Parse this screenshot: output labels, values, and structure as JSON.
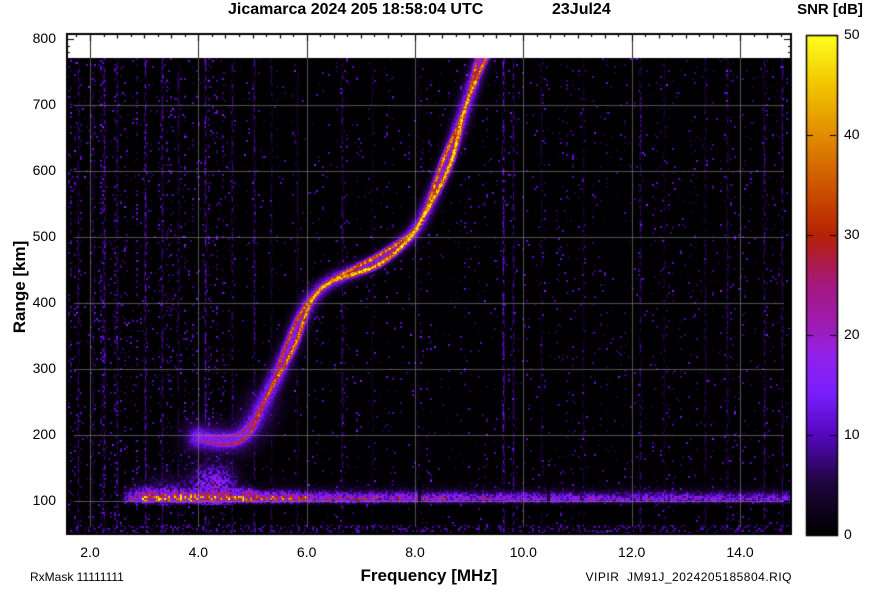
{
  "header": {
    "title": "Jicamarca 2024 205 18:58:04 UTC",
    "date": "23Jul24"
  },
  "colorbar": {
    "label": "SNR [dB]",
    "min": 0,
    "max": 50,
    "tick_labels": [
      "0",
      "10",
      "20",
      "30",
      "40",
      "50"
    ]
  },
  "axes": {
    "x_label": "Frequency [MHz]",
    "y_label": "Range [km]",
    "x_tick_labels": [
      "2.0",
      "4.0",
      "6.0",
      "8.0",
      "10.0",
      "12.0",
      "14.0"
    ],
    "y_tick_labels": [
      "100",
      "200",
      "300",
      "400",
      "500",
      "600",
      "700",
      "800"
    ]
  },
  "footer": {
    "rx_mask": "RxMask 11111111",
    "file": "VIPIR  JM91J_2024205185804.RIQ"
  },
  "chart_data": {
    "type": "heatmap",
    "title": "Jicamarca 2024 205 18:58:04 UTC",
    "date": "23Jul24",
    "xlabel": "Frequency [MHz]",
    "ylabel": "Range [km]",
    "colorbar_label": "SNR [dB]",
    "xlim": [
      1.55,
      14.97
    ],
    "ylim": [
      48,
      809
    ],
    "snr_lim": [
      0,
      50
    ],
    "grid": true,
    "x_major_ticks": [
      2,
      4,
      6,
      8,
      10,
      12,
      14
    ],
    "x_minor_step": 0.25,
    "y_major_ticks": [
      100,
      200,
      300,
      400,
      500,
      600,
      700,
      800
    ],
    "y_minor_step": 10,
    "colorbar_ticks": [
      0,
      10,
      20,
      30,
      40,
      50
    ],
    "palette_stops": [
      [
        0.0,
        "#000000"
      ],
      [
        0.1,
        "#1e053c"
      ],
      [
        0.2,
        "#5508be"
      ],
      [
        0.28,
        "#781efc"
      ],
      [
        0.36,
        "#9422eb"
      ],
      [
        0.42,
        "#9e1cb4"
      ],
      [
        0.5,
        "#a51882"
      ],
      [
        0.6,
        "#b62205"
      ],
      [
        0.7,
        "#cd5500"
      ],
      [
        0.8,
        "#e28c00"
      ],
      [
        0.9,
        "#f2c400"
      ],
      [
        1.0,
        "#ffff1e"
      ]
    ],
    "f_trace": {
      "description": "F-region echo trace, braided O/X double strand, asymptoting near foF2",
      "critical_frequency_mhz": 9.3,
      "points": [
        [
          4.0,
          197
        ],
        [
          4.35,
          193
        ],
        [
          4.7,
          195
        ],
        [
          4.95,
          212
        ],
        [
          5.2,
          250
        ],
        [
          5.45,
          292
        ],
        [
          5.7,
          338
        ],
        [
          5.95,
          388
        ],
        [
          6.2,
          418
        ],
        [
          6.5,
          436
        ],
        [
          6.9,
          450
        ],
        [
          7.3,
          465
        ],
        [
          7.7,
          488
        ],
        [
          8.0,
          512
        ],
        [
          8.25,
          550
        ],
        [
          8.5,
          598
        ],
        [
          8.7,
          642
        ],
        [
          8.9,
          692
        ],
        [
          9.05,
          730
        ],
        [
          9.18,
          762
        ],
        [
          9.25,
          776
        ]
      ],
      "core_snr_db": [
        [
          3.9,
          22
        ],
        [
          4.5,
          27
        ],
        [
          4.9,
          30
        ],
        [
          5.3,
          36
        ],
        [
          5.8,
          41
        ],
        [
          6.2,
          45
        ],
        [
          6.6,
          47
        ],
        [
          8.6,
          47
        ],
        [
          8.9,
          45
        ],
        [
          9.1,
          41
        ],
        [
          9.3,
          36
        ]
      ]
    },
    "e_layer": {
      "description": "E-region echo band near 100 km across all frequencies",
      "center_km": 103,
      "snr_profile": [
        [
          2.5,
          0
        ],
        [
          2.8,
          18
        ],
        [
          3.0,
          29
        ],
        [
          3.6,
          32
        ],
        [
          4.4,
          31
        ],
        [
          5.0,
          27
        ],
        [
          5.6,
          23
        ],
        [
          6.5,
          19
        ],
        [
          8.0,
          16.5
        ],
        [
          10.0,
          14.5
        ],
        [
          12.0,
          13.5
        ],
        [
          15.0,
          12.5
        ]
      ],
      "spread_bump": {
        "freq_mhz": 4.3,
        "top_km": 185
      },
      "gaps_mhz": [
        8.07,
        10.45
      ]
    },
    "rfi_columns": [
      [
        1.78,
        8
      ],
      [
        2.06,
        6
      ],
      [
        2.25,
        10
      ],
      [
        2.5,
        7
      ],
      [
        3.02,
        12
      ],
      [
        3.32,
        9
      ],
      [
        3.62,
        7
      ],
      [
        4.12,
        12
      ],
      [
        4.62,
        8
      ],
      [
        5.02,
        9
      ],
      [
        5.35,
        6
      ],
      [
        5.82,
        5
      ],
      [
        6.66,
        8
      ],
      [
        7.2,
        4
      ],
      [
        8.06,
        4
      ],
      [
        9.62,
        13
      ],
      [
        9.8,
        9
      ],
      [
        10.32,
        5
      ],
      [
        11.1,
        4
      ],
      [
        12.16,
        8
      ],
      [
        12.6,
        4
      ],
      [
        13.36,
        6
      ],
      [
        13.76,
        7
      ],
      [
        14.45,
        9
      ],
      [
        14.78,
        8
      ]
    ],
    "background_noise": {
      "dense_below_mhz": 4.7,
      "speckle_db_range": [
        3,
        14
      ],
      "bottom_band_below_km": 64
    }
  }
}
